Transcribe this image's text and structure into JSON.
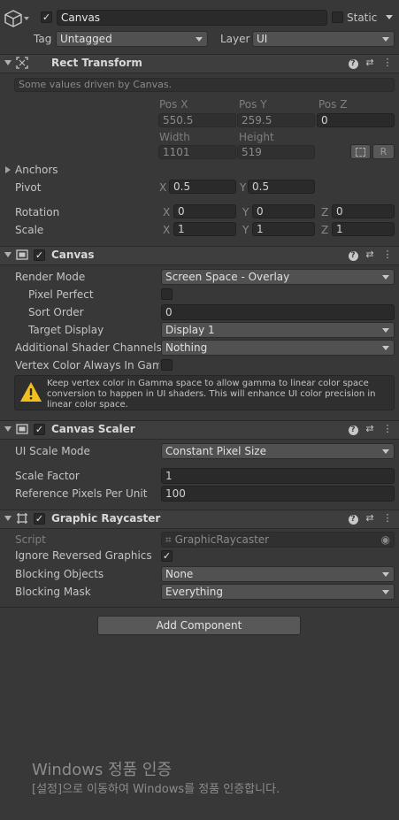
{
  "object": {
    "name": "Canvas",
    "static_label": "Static",
    "tag_label": "Tag",
    "tag_value": "Untagged",
    "layer_label": "Layer",
    "layer_value": "UI"
  },
  "rect_transform": {
    "title": "Rect Transform",
    "driven_note": "Some values driven by Canvas.",
    "pos_x_label": "Pos X",
    "pos_y_label": "Pos Y",
    "pos_z_label": "Pos Z",
    "pos_x": "550.5",
    "pos_y": "259.5",
    "pos_z": "0",
    "width_label": "Width",
    "height_label": "Height",
    "width": "1101",
    "height": "519",
    "r_button": "R",
    "anchors_label": "Anchors",
    "pivot_label": "Pivot",
    "pivot_x": "0.5",
    "pivot_y": "0.5",
    "rotation_label": "Rotation",
    "rot_x": "0",
    "rot_y": "0",
    "rot_z": "0",
    "scale_label": "Scale",
    "scale_x": "1",
    "scale_y": "1",
    "scale_z": "1",
    "x": "X",
    "y": "Y",
    "z": "Z"
  },
  "canvas": {
    "title": "Canvas",
    "render_mode_label": "Render Mode",
    "render_mode": "Screen Space - Overlay",
    "pixel_perfect_label": "Pixel Perfect",
    "sort_order_label": "Sort Order",
    "sort_order": "0",
    "target_display_label": "Target Display",
    "target_display": "Display 1",
    "shader_channels_label": "Additional Shader Channels",
    "shader_channels": "Nothing",
    "vertex_color_label": "Vertex Color Always In Gamm",
    "warning": "Keep vertex color in Gamma space to allow gamma to linear color space conversion to happen in UI shaders. This will enhance UI color precision in linear color space."
  },
  "canvas_scaler": {
    "title": "Canvas Scaler",
    "ui_scale_mode_label": "UI Scale Mode",
    "ui_scale_mode": "Constant Pixel Size",
    "scale_factor_label": "Scale Factor",
    "scale_factor": "1",
    "ref_ppu_label": "Reference Pixels Per Unit",
    "ref_ppu": "100"
  },
  "graphic_raycaster": {
    "title": "Graphic Raycaster",
    "script_label": "Script",
    "script_value": "GraphicRaycaster",
    "ignore_reversed_label": "Ignore Reversed Graphics",
    "blocking_objects_label": "Blocking Objects",
    "blocking_objects": "None",
    "blocking_mask_label": "Blocking Mask",
    "blocking_mask": "Everything"
  },
  "add_component": "Add Component",
  "watermark": {
    "line1": "Windows 정품 인증",
    "line2": "[설정]으로 이동하여 Windows를 정품 인증합니다."
  },
  "colors": {
    "background": "#383838",
    "header": "#3e3e3e",
    "field": "#2a2a2a",
    "warning_icon": "#f2c01e"
  }
}
